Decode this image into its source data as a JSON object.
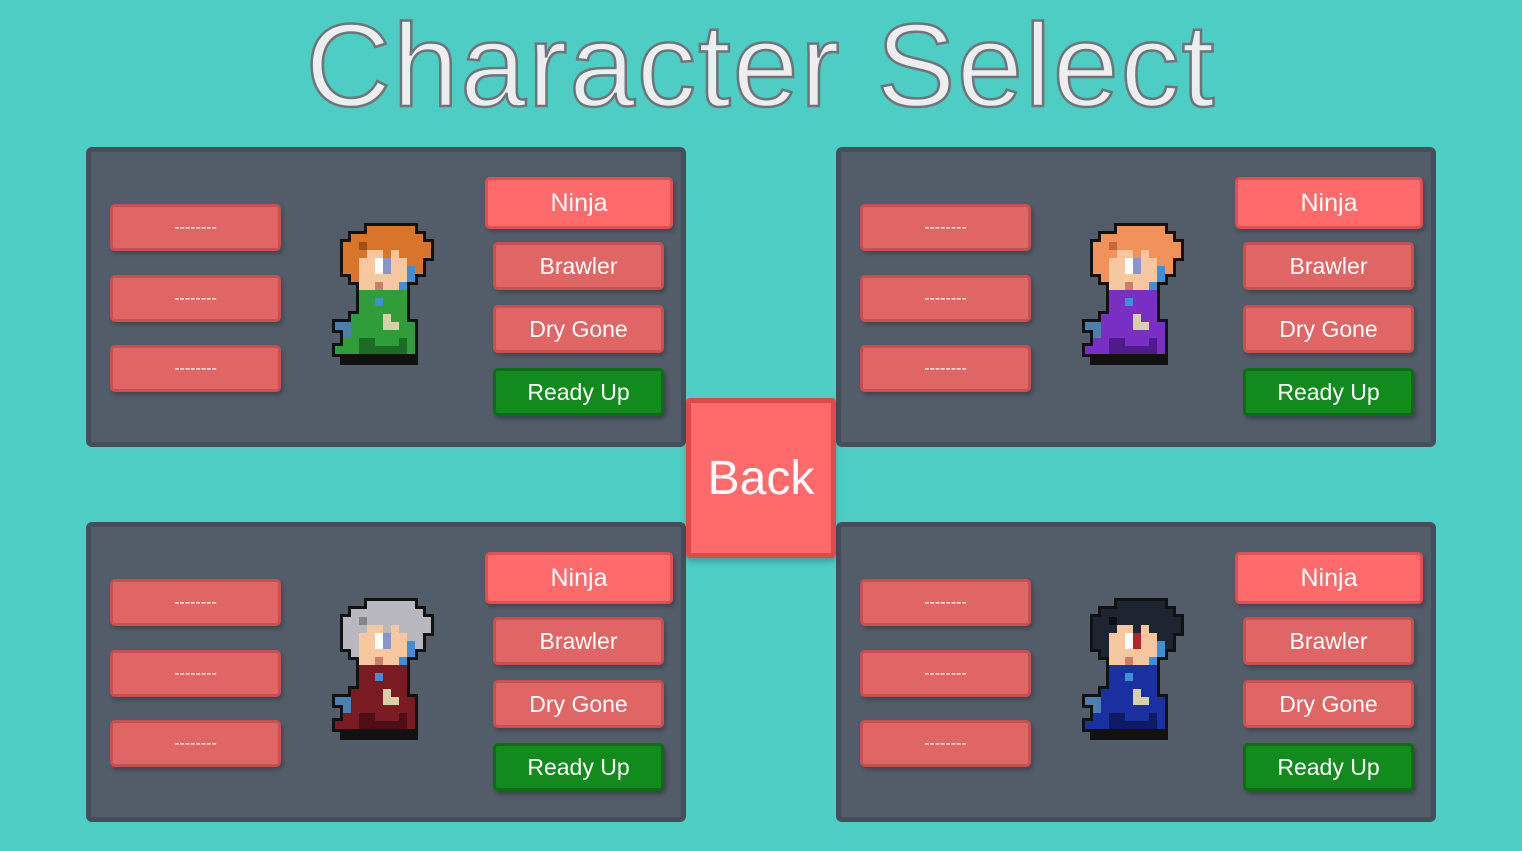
{
  "title": "Character Select",
  "back_label": "Back",
  "colors": {
    "background": "#4ecdc4",
    "panel": "#535d69",
    "button": "#e06666",
    "ninja_button": "#ff6b6b",
    "ready_button": "#118c1c"
  },
  "players": [
    {
      "slots": [
        "--------",
        "--------",
        "--------"
      ],
      "classes": {
        "ninja": "Ninja",
        "brawler": "Brawler",
        "dry_gone": "Dry Gone"
      },
      "ready_label": "Ready Up",
      "sprite": {
        "hair": "#d9742b",
        "hair_dark": "#a24f14",
        "robe": "#2f9e3a",
        "robe_dark": "#1d6b25",
        "eye": "#8a95c9"
      }
    },
    {
      "slots": [
        "--------",
        "--------",
        "--------"
      ],
      "classes": {
        "ninja": "Ninja",
        "brawler": "Brawler",
        "dry_gone": "Dry Gone"
      },
      "ready_label": "Ready Up",
      "sprite": {
        "hair": "#f0925a",
        "hair_dark": "#c9683a",
        "robe": "#7a2fc4",
        "robe_dark": "#4f1a8a",
        "eye": "#8a95c9"
      }
    },
    {
      "slots": [
        "--------",
        "--------",
        "--------"
      ],
      "classes": {
        "ninja": "Ninja",
        "brawler": "Brawler",
        "dry_gone": "Dry Gone"
      },
      "ready_label": "Ready Up",
      "sprite": {
        "hair": "#b8b8be",
        "hair_dark": "#85858c",
        "robe": "#7a1a22",
        "robe_dark": "#4f0e14",
        "eye": "#8a95c9"
      }
    },
    {
      "slots": [
        "--------",
        "--------",
        "--------"
      ],
      "classes": {
        "ninja": "Ninja",
        "brawler": "Brawler",
        "dry_gone": "Dry Gone"
      },
      "ready_label": "Ready Up",
      "sprite": {
        "hair": "#1e2530",
        "hair_dark": "#0b0f14",
        "robe": "#1a2fa0",
        "robe_dark": "#0e1a66",
        "eye": "#b0262a"
      }
    }
  ]
}
